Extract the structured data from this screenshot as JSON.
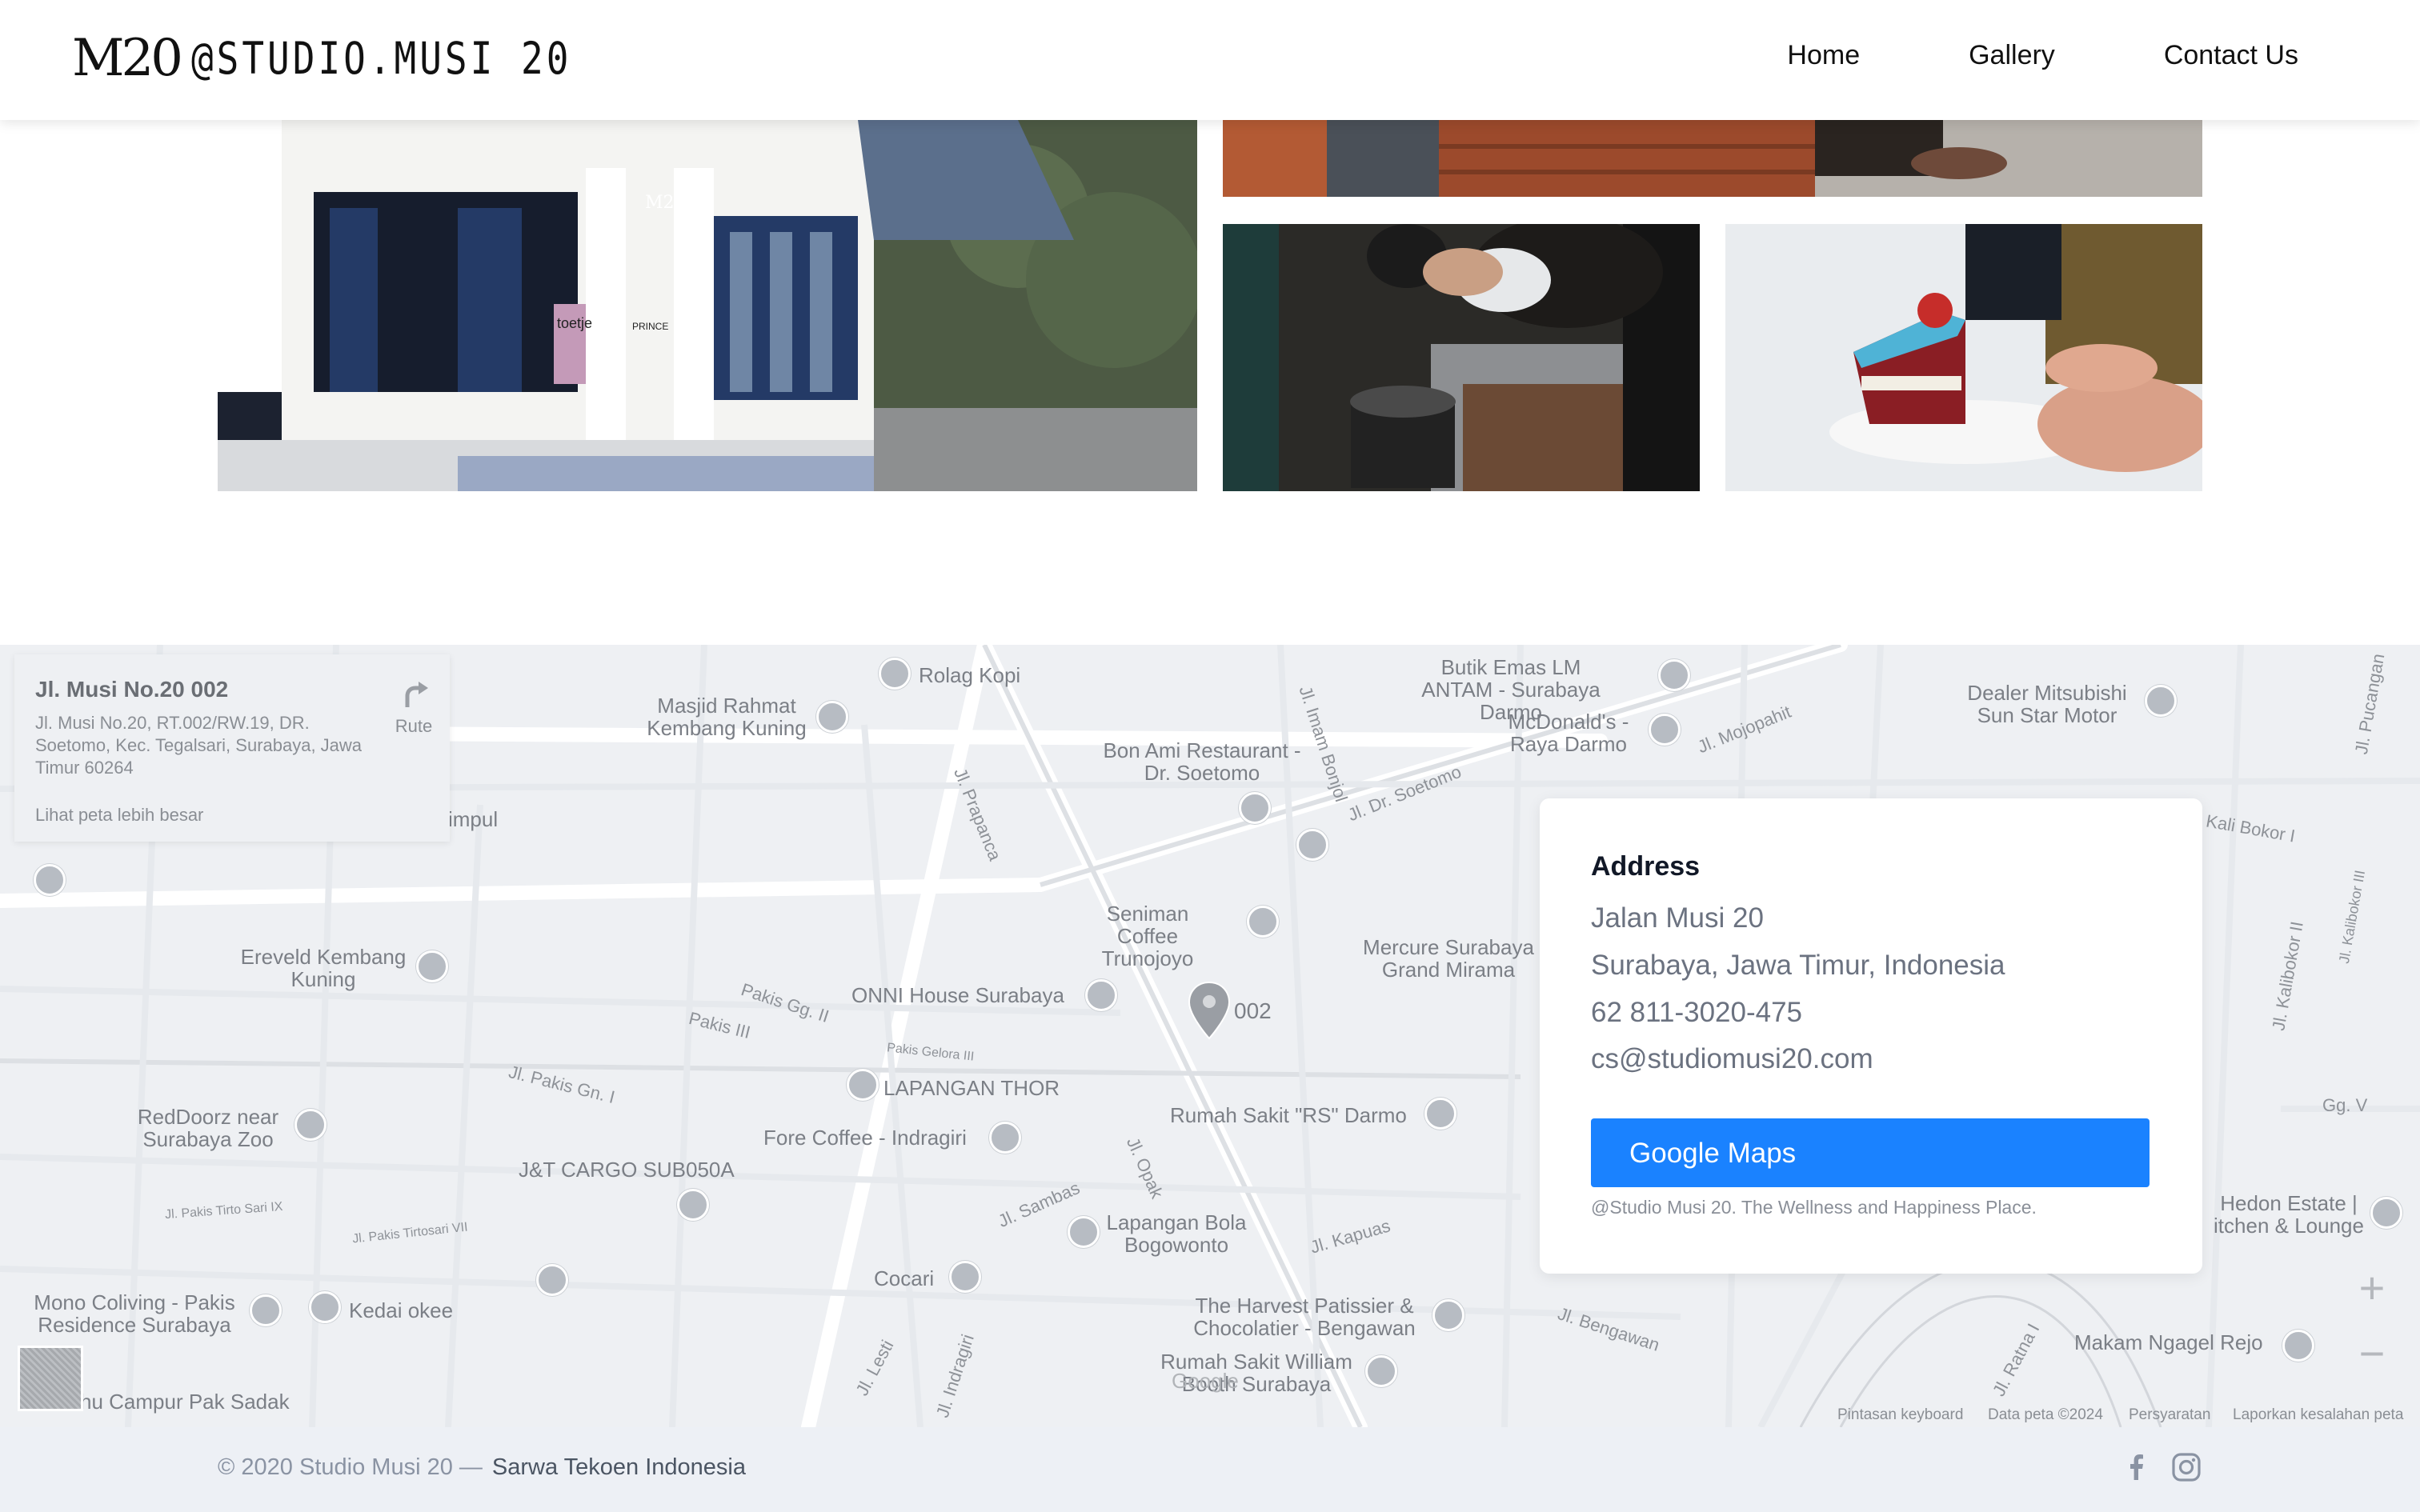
{
  "header": {
    "logo_mark": "M20",
    "logo_text": "@STUDIO.MUSI 20",
    "nav": [
      {
        "label": "Home"
      },
      {
        "label": "Gallery"
      },
      {
        "label": "Contact Us"
      }
    ]
  },
  "gallery": {
    "photos": [
      {
        "subject": "studio-building-exterior"
      },
      {
        "subject": "brick-wall-floor"
      },
      {
        "subject": "barista-pour-over"
      },
      {
        "subject": "cake-slice"
      }
    ],
    "photo_signs": {
      "building_sign": "M20",
      "poster": "toetje",
      "prince": "PRINCE"
    }
  },
  "map": {
    "place_card": {
      "title": "Jl. Musi No.20 002",
      "address": "Jl. Musi No.20, RT.002/RW.19, DR. Soetomo, Kec. Tegalsari, Surabaya, Jawa Timur 60264",
      "larger_map": "Lihat peta lebih besar",
      "route": "Rute"
    },
    "pin_label": "002",
    "labels": [
      "Rolag Kopi",
      "Masjid Rahmat Kembang Kuning",
      "Butik Emas LM ANTAM - Surabaya Darmo",
      "McDonald's - Raya Darmo",
      "Dealer Mitsubishi Sun Star Motor",
      "Bon Ami Restaurant - Dr. Soetomo",
      "Jl. Imam Bonjol",
      "Jl. Dr. Soetomo",
      "Jl. Mojopahit",
      "Jl. Prapanca",
      "Seniman Coffee Trunojoyo",
      "Mercure Surabaya Grand Mirama",
      "Ereveld Kembang Kuning",
      "ONNI House Surabaya",
      "Pakis Gg. II",
      "Pakis III",
      "Pakis Gelora III",
      "LAPANGAN THOR",
      "Jl. Pakis Gn. I",
      "Rumah Sakit \"RS\" Darmo",
      "RedDoorz near Surabaya Zoo",
      "Fore Coffee - Indragiri",
      "J&T CARGO SUB050A",
      "Jl. Opak",
      "Jl. Sambas",
      "Lapangan Bola Bogowonto",
      "Jl. Kapuas",
      "Jl. Pakis Tirto Sari IX",
      "Jl. Pakis Tirtosari VII",
      "Cocari",
      "Mono Coliving - Pakis Residence Surabaya",
      "Kedai okee",
      "The Harvest Patissier & Chocolatier - Bengawan",
      "Jl. Bengawan",
      "Rumah Sakit William Booth Surabaya",
      "Jl. Lesti",
      "Jl. Indragiri",
      "hu Campur Pak Sadak",
      "Makam Ngagel Rejo",
      "Hedon Estate | itchen & Lounge",
      "Kali Bokor I",
      "Jl. Kalibokor II",
      "Jl. Kalibokor III",
      "Jl. Pucangan",
      "Gg. V",
      "Jl. Ratna I",
      "impul",
      "Google"
    ],
    "attribution": [
      "Pintasan keyboard",
      "Data peta ©2024",
      "Persyaratan",
      "Laporkan kesalahan peta"
    ]
  },
  "contact": {
    "title": "Address",
    "lines": [
      "Jalan Musi 20",
      "Surabaya, Jawa Timur, Indonesia",
      "62 811-3020-475",
      "cs@studiomusi20.com"
    ],
    "button": "Google Maps",
    "note": "@Studio Musi 20. The Wellness and Happiness Place."
  },
  "footer": {
    "copyright": "© 2020 Studio Musi 20 —",
    "brand": "Sarwa Tekoen Indonesia",
    "social": [
      "facebook-icon",
      "instagram-icon"
    ]
  },
  "colors": {
    "accent": "#1a82ff",
    "footer_bg": "#edf0f5",
    "map_bg": "#eef0f3"
  }
}
